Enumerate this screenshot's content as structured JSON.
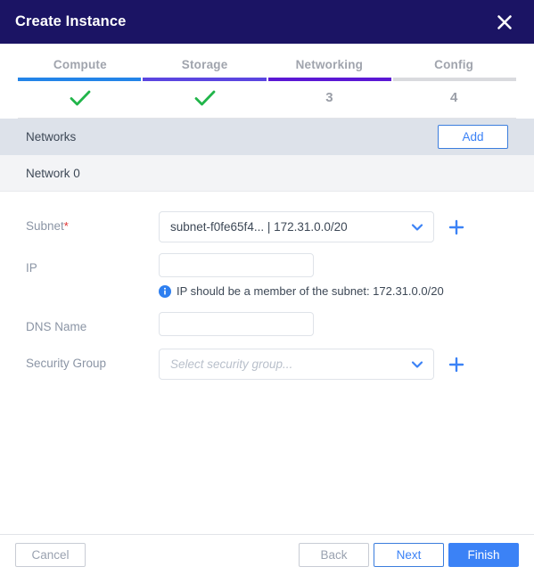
{
  "dialog": {
    "title": "Create Instance",
    "close_icon": "close-icon"
  },
  "stepper": {
    "steps": [
      {
        "label": "Compute",
        "mark": "✓",
        "state": "complete",
        "color": "#2384e8"
      },
      {
        "label": "Storage",
        "mark": "✓",
        "state": "complete",
        "color": "#5b45e0"
      },
      {
        "label": "Networking",
        "mark": "3",
        "state": "current",
        "color": "#5b17d4"
      },
      {
        "label": "Config",
        "mark": "4",
        "state": "upcoming",
        "color": "#d9dade"
      }
    ],
    "check_color": "#21b54a",
    "mark_color": "#9a9ea7"
  },
  "networks_section": {
    "title": "Networks",
    "add_label": "Add",
    "network_label": "Network 0"
  },
  "form": {
    "subnet": {
      "label": "Subnet",
      "required_marker": "*",
      "value": "subnet-f0fe65f4... | 172.31.0.0/20",
      "chevron_icon": "chevron-down-icon",
      "add_icon": "plus-icon"
    },
    "ip": {
      "label": "IP",
      "value": "",
      "placeholder": "",
      "hint": "IP should be a member of the subnet: 172.31.0.0/20",
      "hint_icon": "info-icon"
    },
    "dns_name": {
      "label": "DNS Name",
      "value": "",
      "placeholder": ""
    },
    "security_group": {
      "label": "Security Group",
      "placeholder": "Select security group...",
      "value": "",
      "chevron_icon": "chevron-down-icon",
      "add_icon": "plus-icon"
    }
  },
  "footer": {
    "cancel_label": "Cancel",
    "back_label": "Back",
    "next_label": "Next",
    "finish_label": "Finish"
  },
  "colors": {
    "header_bg": "#1b1464",
    "accent_blue": "#3b82f6",
    "section_bg": "#dde2ea",
    "subrow_bg": "#f3f4f6",
    "required_red": "#e03030",
    "check_green": "#21b54a"
  }
}
